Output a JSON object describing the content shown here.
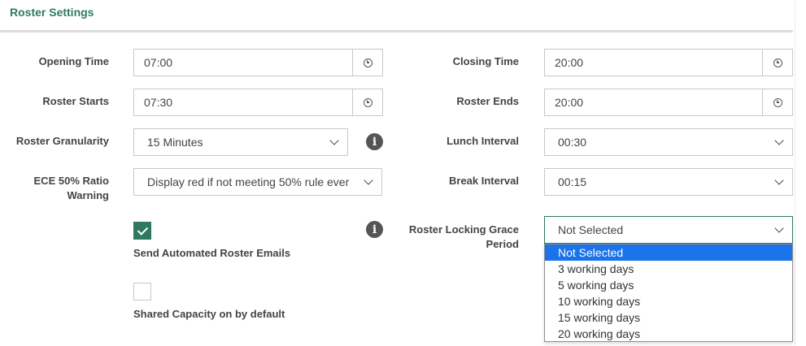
{
  "panel": {
    "title": "Roster Settings"
  },
  "opening_time": {
    "label": "Opening Time",
    "value": "07:00"
  },
  "closing_time": {
    "label": "Closing Time",
    "value": "20:00"
  },
  "roster_starts": {
    "label": "Roster Starts",
    "value": "07:30"
  },
  "roster_ends": {
    "label": "Roster Ends",
    "value": "20:00"
  },
  "roster_granularity": {
    "label": "Roster Granularity",
    "value": "15 Minutes"
  },
  "lunch_interval": {
    "label": "Lunch Interval",
    "value": "00:30"
  },
  "ece_ratio": {
    "label_line1": "ECE 50% Ratio",
    "label_line2": "Warning",
    "value": "Display red if not meeting 50% rule ever"
  },
  "break_interval": {
    "label": "Break Interval",
    "value": "00:15"
  },
  "send_emails": {
    "label": "Send Automated Roster Emails",
    "checked": true
  },
  "shared_capacity": {
    "label": "Shared Capacity on by default",
    "checked": false
  },
  "roster_locking": {
    "label_line1": "Roster Locking Grace",
    "label_line2": "Period",
    "value": "Not Selected",
    "options": [
      "Not Selected",
      "3 working days",
      "5 working days",
      "10 working days",
      "15 working days",
      "20 working days"
    ],
    "highlighted_option": "Not Selected"
  },
  "icons": {
    "time": "clock-icon",
    "info": "info-icon",
    "select": "chevron-down-icon",
    "check": "checkmark-icon"
  },
  "colors": {
    "accent": "#2f7a5f",
    "option_highlight": "#1a73e8",
    "border": "#c8c8c8"
  }
}
